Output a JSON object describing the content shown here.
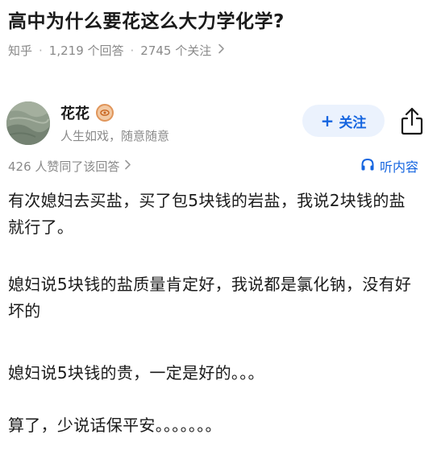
{
  "question": {
    "title": "高中为什么要花这么大力学化学?"
  },
  "meta": {
    "source": "知乎",
    "answers": "1,219 个回答",
    "followers": "2745 个关注"
  },
  "author": {
    "name": "花花",
    "bio": "人生如戏，随意随意"
  },
  "actions": {
    "follow_label": "关注",
    "listen_label": "听内容"
  },
  "votes": {
    "text": "426 人赞同了该回答"
  },
  "answer": {
    "paragraphs": [
      "有次媳妇去买盐，买了包5块钱的岩盐，我说2块钱的盐就行了。",
      "媳妇说5块钱的盐质量肯定好，我说都是氯化钠，没有好坏的",
      "媳妇说5块钱的贵，一定是好的。。。",
      "算了，少说话保平安。。。。。。。"
    ]
  },
  "colors": {
    "accent": "#1565e0",
    "follow_bg": "#ebf2fd",
    "muted_text": "#8a8a8a"
  }
}
